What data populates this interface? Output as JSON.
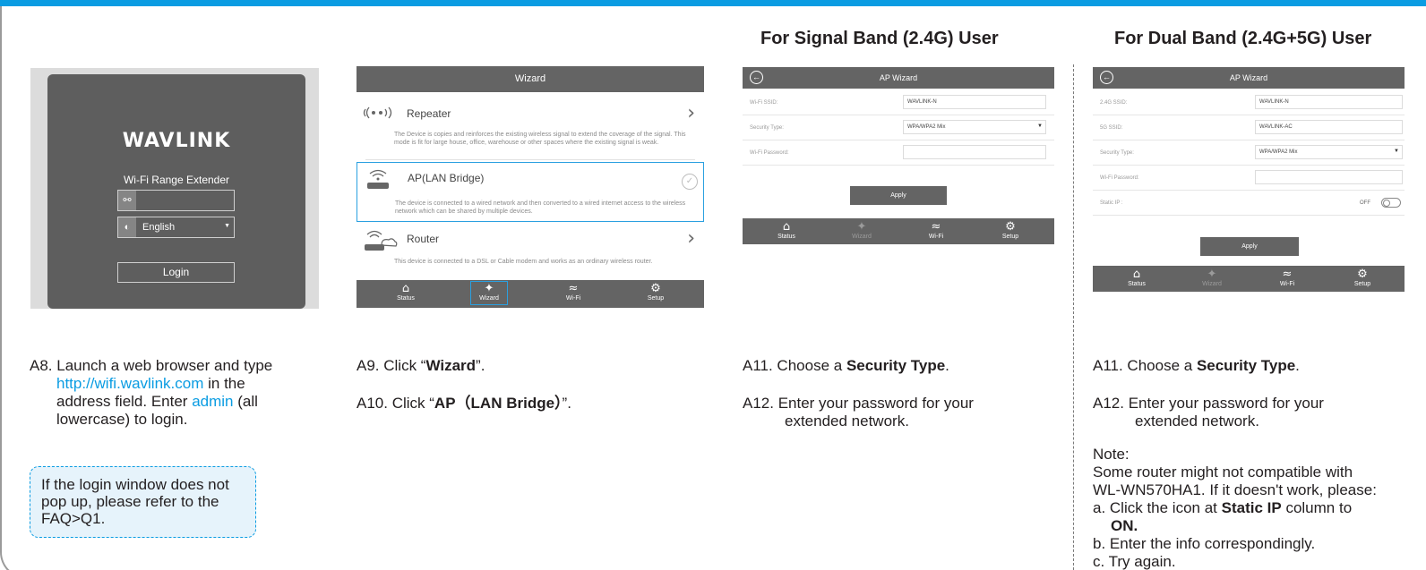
{
  "headings": {
    "single": "For Signal Band (2.4G) User",
    "dual": "For Dual Band (2.4G+5G) User"
  },
  "login": {
    "brand": "WAVLINK",
    "subtitle": "Wi-Fi Range Extender",
    "password_value": "",
    "language": "English",
    "login_label": "Login"
  },
  "wizard": {
    "title": "Wizard",
    "items": [
      {
        "title": "Repeater",
        "desc": "The Device is copies and reinforces the existing wireless signal to extend the coverage of the signal. This mode is fit for large house, office, warehouse or other spaces where the existing signal is weak."
      },
      {
        "title": "AP(LAN Bridge)",
        "desc": "The device is connected to a wired network and then converted to a wired internet access to the wireless network which can be shared by multiple devices."
      },
      {
        "title": "Router",
        "desc": "This device is connected to a DSL or Cable modem and works as an ordinary wireless router."
      }
    ],
    "tabs": [
      "Status",
      "Wizard",
      "Wi-Fi",
      "Setup"
    ]
  },
  "ap_single": {
    "title": "AP Wizard",
    "ssid_label": "Wi-Fi SSID:",
    "ssid_value": "WAVLINK-N",
    "security_label": "Security Type:",
    "security_value": "WPA/WPA2 Mix",
    "password_label": "Wi-Fi Password:",
    "password_value": "",
    "apply_label": "Apply",
    "tabs": [
      "Status",
      "Wizard",
      "Wi-Fi",
      "Setup"
    ]
  },
  "ap_dual": {
    "title": "AP Wizard",
    "ssid24_label": "2.4G SSID:",
    "ssid24_value": "WAVLINK-N",
    "ssid5_label": "5G SSID:",
    "ssid5_value": "WAVLINK-AC",
    "security_label": "Security Type:",
    "security_value": "WPA/WPA2 Mix",
    "password_label": "Wi-Fi Password:",
    "password_value": "",
    "static_ip_label": "Static IP :",
    "static_ip_state": "OFF",
    "apply_label": "Apply",
    "tabs": [
      "Status",
      "Wizard",
      "Wi-Fi",
      "Setup"
    ]
  },
  "instructions": {
    "a8_prefix": "A8. Launch a web browser and type",
    "a8_url": "http://wifi.wavlink.com",
    "a8_mid": " in the",
    "a8_line2": "address field. Enter ",
    "a8_admin": "admin",
    "a8_line2_end": " (all",
    "a8_line3": "lowercase) to login.",
    "note": "If the login window does not pop up, please refer to the FAQ>Q1.",
    "a9_prefix": "A9. Click “",
    "a9_bold": "Wizard",
    "a9_suffix": "”.",
    "a10_prefix": "A10. Click “",
    "a10_bold": "AP（LAN  Bridge）",
    "a10_suffix": "”.",
    "a11_prefix": "A11. Choose  a  ",
    "a11_bold": "Security  Type",
    "a11_suffix": ".",
    "a12_line1": "A12. Enter  your  password  for  your",
    "a12_line2": "extended  network.",
    "dual_note_title": "Note:",
    "dual_note_line1": "Some router might not compatible with",
    "dual_note_line2": "WL-WN570HA1. If it doesn't work, please:",
    "dual_note_a_prefix": "a. Click the icon at ",
    "dual_note_a_bold": "Static IP",
    "dual_note_a_suffix": " column to",
    "dual_note_a_bold2": "ON.",
    "dual_note_b": "b. Enter the info correspondingly.",
    "dual_note_c": "c. Try again."
  }
}
